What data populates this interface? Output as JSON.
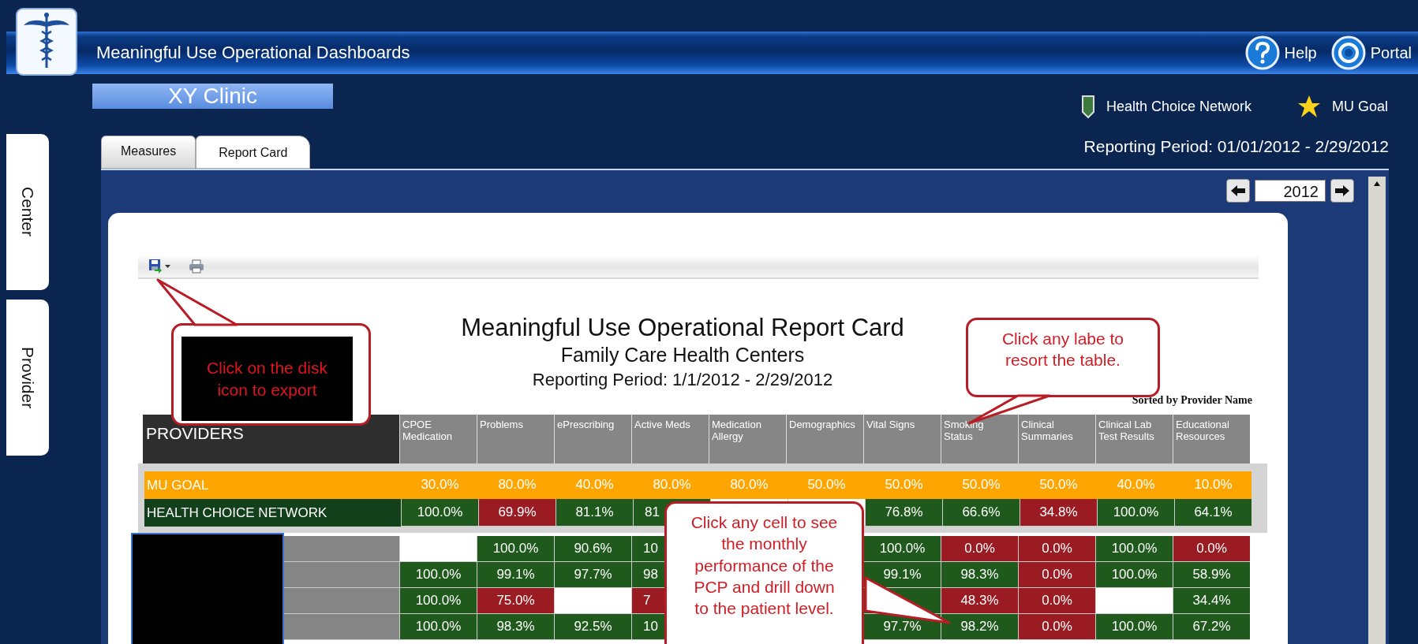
{
  "app": {
    "title": "Meaningful Use Operational Dashboards",
    "clinic": "XY Clinic",
    "links": [
      {
        "kind": "help",
        "label": "Help"
      },
      {
        "kind": "portal",
        "label": "Portal"
      }
    ]
  },
  "side_tabs": [
    {
      "label": "Center"
    },
    {
      "label": "Provider"
    }
  ],
  "legend": [
    {
      "kind": "network",
      "label": "Health Choice Network"
    },
    {
      "kind": "goal",
      "label": "MU Goal"
    }
  ],
  "reporting_period": "Reporting Period: 01/01/2012 - 2/29/2012",
  "tabs": [
    {
      "label": "Measures",
      "selected": false
    },
    {
      "label": "Report Card",
      "selected": true
    }
  ],
  "year": "2012",
  "report": {
    "title": "Meaningful Use Operational Report Card",
    "subtitle": "Family Care Health Centers",
    "period": "Reporting Period: 1/1/2012 - 2/29/2012",
    "sort_note": "Sorted by Provider Name",
    "table": {
      "corner": "PROVIDERS",
      "columns": [
        "CPOE Medication",
        "Problems",
        "ePrescribing",
        "Active Meds",
        "Medication Allergy",
        "Demographics",
        "Vital Signs",
        "Smoking Status",
        "Clinical Summaries",
        "Clinical Lab Test Results",
        "Educational Resources"
      ],
      "summary_rows": [
        {
          "kind": "goal",
          "name": "MU GOAL",
          "cells": [
            {
              "kind": "goal",
              "value": "30.0%"
            },
            {
              "kind": "goal",
              "value": "80.0%"
            },
            {
              "kind": "goal",
              "value": "40.0%"
            },
            {
              "kind": "goal",
              "value": "80.0%"
            },
            {
              "kind": "goal",
              "value": "80.0%"
            },
            {
              "kind": "goal",
              "value": "50.0%"
            },
            {
              "kind": "goal",
              "value": "50.0%"
            },
            {
              "kind": "goal",
              "value": "50.0%"
            },
            {
              "kind": "goal",
              "value": "50.0%"
            },
            {
              "kind": "goal",
              "value": "40.0%"
            },
            {
              "kind": "goal",
              "value": "10.0%"
            }
          ]
        },
        {
          "kind": "network",
          "name": "HEALTH CHOICE NETWORK",
          "cells": [
            {
              "kind": "good",
              "value": "100.0%"
            },
            {
              "kind": "bad",
              "value": "69.9%"
            },
            {
              "kind": "good",
              "value": "81.1%"
            },
            {
              "kind": "good",
              "value": "81"
            },
            {
              "kind": "hidden"
            },
            {
              "kind": "hidden"
            },
            {
              "kind": "good",
              "value": "76.8%"
            },
            {
              "kind": "good",
              "value": "66.6%"
            },
            {
              "kind": "bad",
              "value": "34.8%"
            },
            {
              "kind": "good",
              "value": "100.0%"
            },
            {
              "kind": "good",
              "value": "64.1%"
            }
          ]
        }
      ],
      "provider_rows": [
        {
          "cells": [
            {
              "kind": "blank"
            },
            {
              "kind": "good",
              "value": "100.0%"
            },
            {
              "kind": "good",
              "value": "90.6%"
            },
            {
              "kind": "good",
              "value": "10"
            },
            {
              "kind": "hidden"
            },
            {
              "kind": "hidden"
            },
            {
              "kind": "good",
              "value": "100.0%"
            },
            {
              "kind": "bad",
              "value": "0.0%"
            },
            {
              "kind": "bad",
              "value": "0.0%"
            },
            {
              "kind": "good",
              "value": "100.0%"
            },
            {
              "kind": "bad",
              "value": "0.0%"
            }
          ]
        },
        {
          "cells": [
            {
              "kind": "good",
              "value": "100.0%"
            },
            {
              "kind": "good",
              "value": "99.1%"
            },
            {
              "kind": "good",
              "value": "97.7%"
            },
            {
              "kind": "good",
              "value": "98"
            },
            {
              "kind": "hidden"
            },
            {
              "kind": "hidden"
            },
            {
              "kind": "good",
              "value": "99.1%"
            },
            {
              "kind": "good",
              "value": "98.3%"
            },
            {
              "kind": "bad",
              "value": "0.0%"
            },
            {
              "kind": "good",
              "value": "100.0%"
            },
            {
              "kind": "good",
              "value": "58.9%"
            }
          ]
        },
        {
          "cells": [
            {
              "kind": "good",
              "value": "100.0%"
            },
            {
              "kind": "bad",
              "value": "75.0%"
            },
            {
              "kind": "blank"
            },
            {
              "kind": "bad",
              "value": "7"
            },
            {
              "kind": "hidden"
            },
            {
              "kind": "hidden"
            },
            {
              "kind": "good"
            },
            {
              "kind": "bad",
              "value": "48.3%"
            },
            {
              "kind": "bad",
              "value": "0.0%"
            },
            {
              "kind": "blank"
            },
            {
              "kind": "good",
              "value": "34.4%"
            }
          ]
        },
        {
          "cells": [
            {
              "kind": "good",
              "value": "100.0%"
            },
            {
              "kind": "good",
              "value": "98.3%"
            },
            {
              "kind": "good",
              "value": "92.5%"
            },
            {
              "kind": "good",
              "value": "10"
            },
            {
              "kind": "hidden"
            },
            {
              "kind": "hidden"
            },
            {
              "kind": "good",
              "value": "97.7%"
            },
            {
              "kind": "good",
              "value": "98.2%"
            },
            {
              "kind": "bad",
              "value": "0.0%"
            },
            {
              "kind": "good",
              "value": "100.0%"
            },
            {
              "kind": "good",
              "value": "67.2%"
            }
          ]
        }
      ]
    }
  },
  "callouts": [
    {
      "kind": "export",
      "text": "Click on the disk icon to export"
    },
    {
      "kind": "sort",
      "text": "Click any labe to resort the table."
    },
    {
      "kind": "drill",
      "text": "Click any cell to see the monthly performance of the PCP and drill down to the patient level."
    }
  ]
}
